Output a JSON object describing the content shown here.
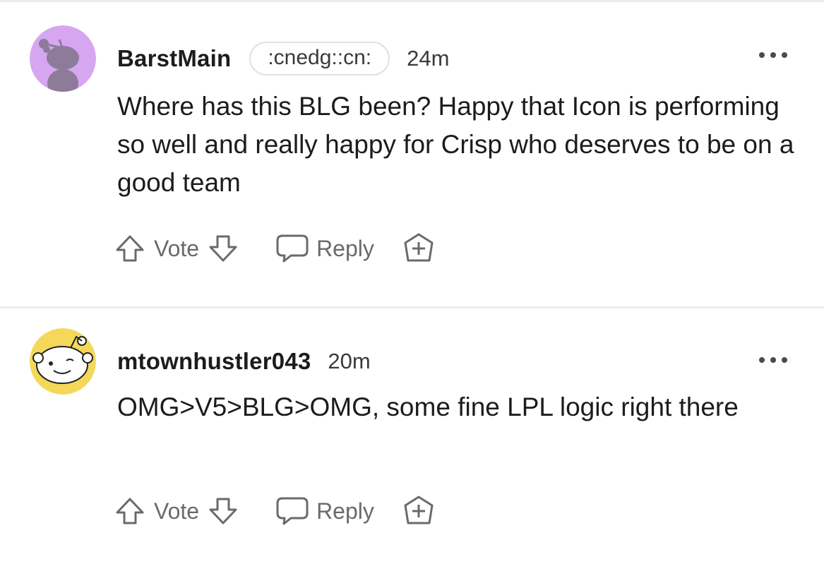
{
  "comments": [
    {
      "username": "BarstMain",
      "flair": ":cnedg::cn:",
      "timestamp": "24m",
      "body": "Where has this BLG been? Happy that Icon is performing so well and really happy for Crisp who deserves to be on a good team",
      "avatar_color": "#d6a6f0",
      "vote_label": "Vote",
      "reply_label": "Reply"
    },
    {
      "username": "mtownhustler043",
      "timestamp": "20m",
      "body": "OMG>V5>BLG>OMG, some fine LPL logic right there",
      "avatar_color": "#f5d85a",
      "vote_label": "Vote",
      "reply_label": "Reply"
    }
  ],
  "icons": {
    "upvote": "arrow-up-outline-icon",
    "downvote": "arrow-down-outline-icon",
    "reply": "speech-bubble-icon",
    "award": "award-plus-icon",
    "more": "ellipsis-icon"
  },
  "colors": {
    "text_primary": "#1c1c1c",
    "text_secondary": "#6a6a6a",
    "divider": "#ececec"
  }
}
